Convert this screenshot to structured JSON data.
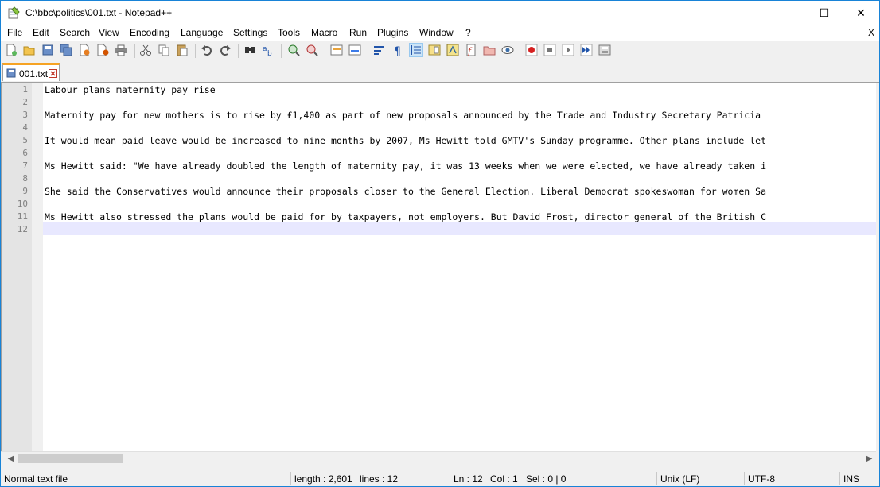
{
  "window": {
    "title": "C:\\bbc\\politics\\001.txt - Notepad++",
    "controls": {
      "minimize": "—",
      "maximize": "☐",
      "close": "✕"
    }
  },
  "menu": {
    "items": [
      "File",
      "Edit",
      "Search",
      "View",
      "Encoding",
      "Language",
      "Settings",
      "Tools",
      "Macro",
      "Run",
      "Plugins",
      "Window",
      "?"
    ],
    "close_doc": "X"
  },
  "toolbar": {
    "icons": [
      "new-file-icon",
      "open-file-icon",
      "save-icon",
      "save-all-icon",
      "close-icon",
      "close-all-icon",
      "print-icon",
      "cut-icon",
      "copy-icon",
      "paste-icon",
      "undo-icon",
      "redo-icon",
      "find-icon",
      "replace-icon",
      "zoom-in-icon",
      "zoom-out-icon",
      "sync-vertical-icon",
      "sync-horizontal-icon",
      "word-wrap-icon",
      "show-all-chars-icon",
      "indent-guide-icon",
      "doc-map-icon",
      "function-list-icon",
      "document-list-icon",
      "folder-as-workspace-icon",
      "monitoring-icon",
      "record-macro-icon",
      "stop-macro-icon",
      "play-macro-icon",
      "run-macro-multiple-icon",
      "save-macro-icon"
    ]
  },
  "tab": {
    "label": "001.txt"
  },
  "editor": {
    "lines": [
      "Labour plans maternity pay rise",
      "",
      "Maternity pay for new mothers is to rise by £1,400 as part of new proposals announced by the Trade and Industry Secretary Patricia ",
      "",
      "It would mean paid leave would be increased to nine months by 2007, Ms Hewitt told GMTV's Sunday programme. Other plans include let",
      "",
      "Ms Hewitt said: \"We have already doubled the length of maternity pay, it was 13 weeks when we were elected, we have already taken i",
      "",
      "She said the Conservatives would announce their proposals closer to the General Election. Liberal Democrat spokeswoman for women Sa",
      "",
      "Ms Hewitt also stressed the plans would be paid for by taxpayers, not employers. But David Frost, director general of the British C",
      ""
    ],
    "current_line": 12
  },
  "statusbar": {
    "file_type": "Normal text file",
    "length": "length : 2,601",
    "lines": "lines : 12",
    "ln": "Ln : 12",
    "col": "Col : 1",
    "sel": "Sel : 0 | 0",
    "eol": "Unix (LF)",
    "encoding": "UTF-8",
    "mode": "INS"
  },
  "colors": {
    "accent_tab": "#f6a324",
    "current_line": "#e8e8ff",
    "gutter": "#e4e4e4"
  }
}
